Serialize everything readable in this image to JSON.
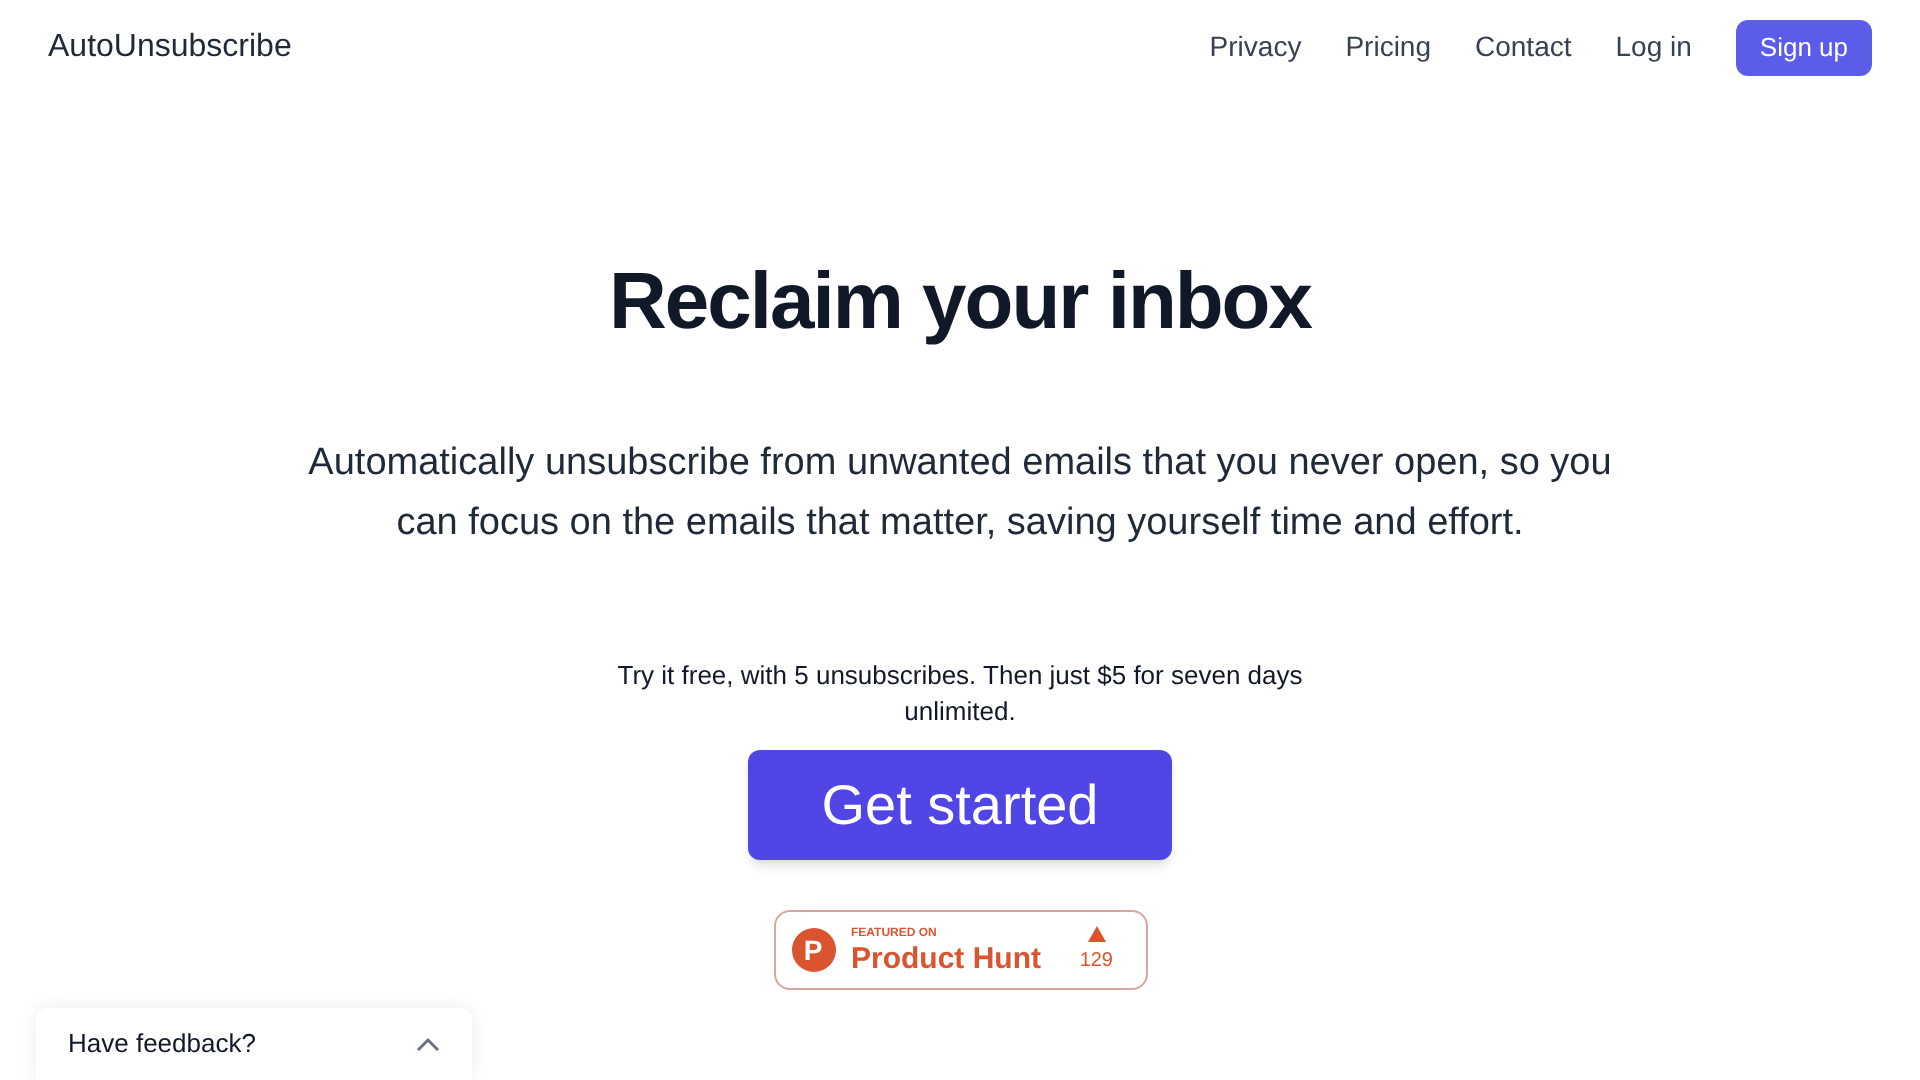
{
  "brand": "AutoUnsubscribe",
  "nav": [
    "Privacy",
    "Pricing",
    "Contact",
    "Log in"
  ],
  "signup": "Sign up",
  "hero": {
    "title": "Reclaim your inbox",
    "subtitle": "Automatically unsubscribe from unwanted emails that you never open, so you can focus on the emails that matter, saving yourself time and effort.",
    "offer": "Try it free, with 5 unsubscribes. Then just $5 for seven days unlimited.",
    "cta": "Get started"
  },
  "badge": {
    "logo_letter": "P",
    "eyebrow": "FEATURED ON",
    "name": "Product Hunt",
    "votes": "129"
  },
  "feedback": {
    "label": "Have feedback?",
    "expanded": false
  }
}
